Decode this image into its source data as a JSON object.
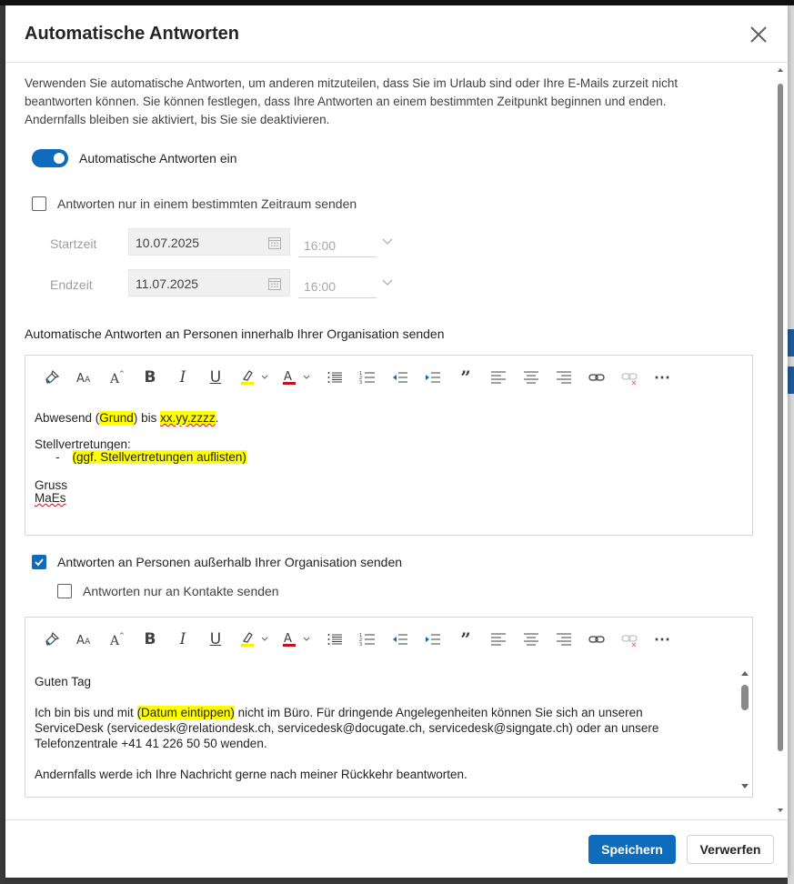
{
  "dialog": {
    "title": "Automatische Antworten",
    "description": "Verwenden Sie automatische Antworten, um anderen mitzuteilen, dass Sie im Urlaub sind oder Ihre E-Mails zurzeit nicht beantworten können. Sie können festlegen, dass Ihre Antworten an einem bestimmten Zeitpunkt beginnen und enden. Andernfalls bleiben sie aktiviert, bis Sie sie deaktivieren.",
    "toggle_label": "Automatische Antworten ein",
    "toggle_on": true
  },
  "schedule": {
    "checkbox_label": "Antworten nur in einem bestimmten Zeitraum senden",
    "checked": false,
    "start_label": "Startzeit",
    "start_date": "10.07.2025",
    "start_time": "16:00",
    "end_label": "Endzeit",
    "end_date": "11.07.2025",
    "end_time": "16:00"
  },
  "internal": {
    "section_label": "Automatische Antworten an Personen innerhalb Ihrer Organisation senden",
    "line1_a": "Abwesend (",
    "line1_b": "Grund",
    "line1_c": ") bis ",
    "line1_d": "xx.yy.zzzz",
    "line1_e": ".",
    "line2": "Stellvertretungen:",
    "line3_dash": "-",
    "line3_text": "(ggf. Stellvertretungen auflisten)",
    "line4": "Gruss",
    "line5": "MaEs"
  },
  "external": {
    "checkbox_label": "Antworten an Personen außerhalb Ihrer Organisation senden",
    "checked": true,
    "contacts_label": "Antworten nur an Kontakte senden",
    "contacts_checked": false,
    "line1": "Guten Tag",
    "line2_a": "Ich bin bis und mit ",
    "line2_b": "(Datum eintippen)",
    "line2_c": " nicht im Büro. Für dringende Angelegenheiten können Sie sich an unseren",
    "line3": "ServiceDesk (servicedesk@relationdesk.ch, servicedesk@docugate.ch, servicedesk@signgate.ch) oder an unsere",
    "line4": "Telefonzentrale +41 41 226 50 50 wenden.",
    "line5": "Andernfalls werde ich Ihre Nachricht gerne nach meiner Rückkehr beantworten."
  },
  "toolbar": {
    "bold": "B",
    "italic": "I",
    "underline": "U",
    "quote": "”",
    "more": "⋯",
    "icons": [
      "format-painter-icon",
      "font-size-icon",
      "grow-font-icon",
      "bold-icon",
      "italic-icon",
      "underline-icon",
      "highlight-icon",
      "font-color-icon",
      "bullets-icon",
      "numbering-icon",
      "decrease-indent-icon",
      "increase-indent-icon",
      "quote-icon",
      "align-left-icon",
      "align-center-icon",
      "align-right-icon",
      "link-icon",
      "unlink-icon",
      "more-icon"
    ]
  },
  "footer": {
    "save": "Speichern",
    "discard": "Verwerfen"
  },
  "colors": {
    "accent": "#0f6cbd",
    "highlight": "#ffff00",
    "font_color": "#c50f1f"
  }
}
